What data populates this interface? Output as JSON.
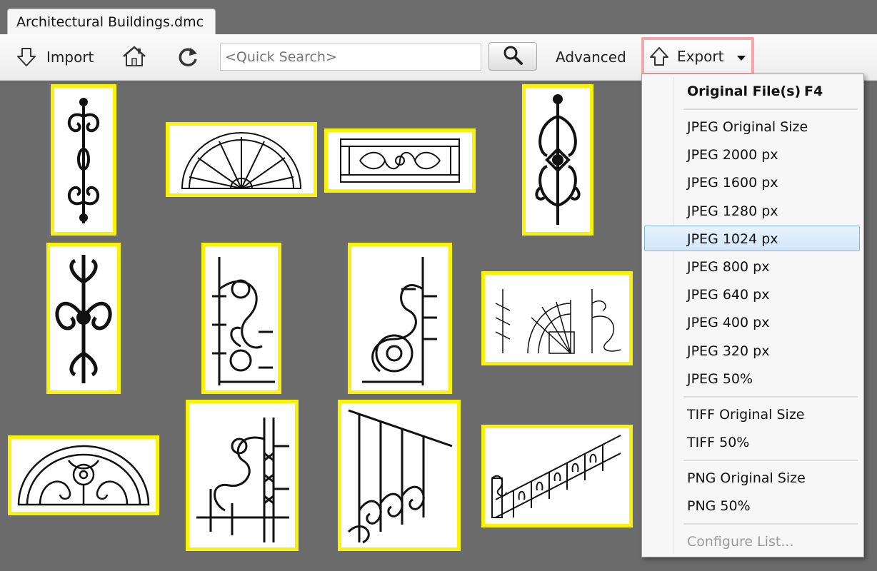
{
  "window": {
    "tab_title": "Architectural Buildings.dmc"
  },
  "toolbar": {
    "import_label": "Import",
    "search_placeholder": "<Quick Search>",
    "advanced_label": "Advanced",
    "export_label": "Export",
    "export_highlight_color": "#f3a7ad"
  },
  "thumbnails": {
    "highlight_color": "#f9f20b",
    "items": [
      "vertical scroll ornament",
      "half-circle fan transom",
      "balustrade panel",
      "vertical diamond ornament",
      "vertical scroll ornament 2",
      "corner bracket",
      "corner bracket 2",
      "fan railing set",
      "half-circle lunette",
      "corner bracket 3",
      "staircase railing",
      "stair balustrade"
    ]
  },
  "export_menu": {
    "items": [
      {
        "label": "Original File(s)",
        "shortcut": "F4",
        "bold": true
      },
      {
        "label": "JPEG Original Size"
      },
      {
        "label": "JPEG 2000 px"
      },
      {
        "label": "JPEG 1600 px"
      },
      {
        "label": "JPEG 1280 px"
      },
      {
        "label": "JPEG 1024 px",
        "selected": true
      },
      {
        "label": "JPEG 800 px"
      },
      {
        "label": "JPEG 640 px"
      },
      {
        "label": "JPEG 400 px"
      },
      {
        "label": "JPEG 320 px"
      },
      {
        "label": "JPEG 50%"
      },
      {
        "label": "TIFF Original Size"
      },
      {
        "label": "TIFF 50%"
      },
      {
        "label": "PNG Original Size"
      },
      {
        "label": "PNG 50%"
      },
      {
        "label": "Configure List...",
        "disabled": true
      }
    ],
    "selected_color": "#d2e6fa"
  }
}
